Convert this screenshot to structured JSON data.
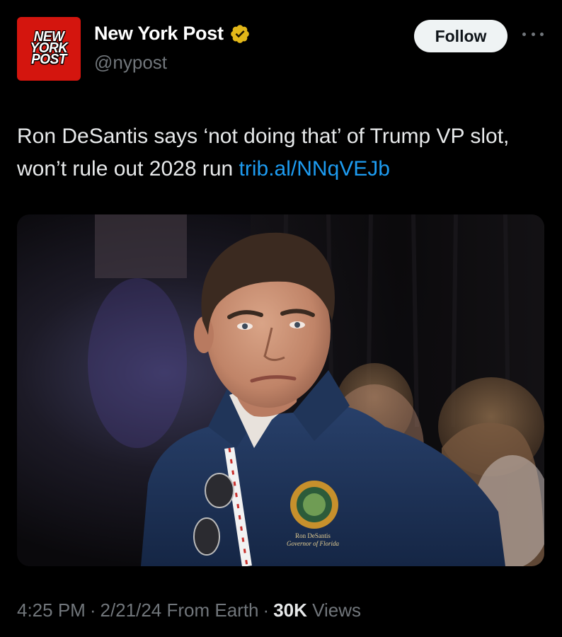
{
  "account": {
    "avatar_lines": [
      "NEW",
      "YORK",
      "POST"
    ],
    "name": "New York Post",
    "handle": "@nypost",
    "verified": true,
    "verified_icon": "verified-badge-icon",
    "badge_color": "#e2b719"
  },
  "actions": {
    "follow_label": "Follow",
    "more_icon": "more-options-icon"
  },
  "tweet": {
    "text": "Ron DeSantis says ‘not doing that’ of Trump VP slot, won’t rule out 2028 run",
    "link_text": "trib.al/NNqVEJb"
  },
  "media": {
    "jacket_seal_name": "Ron DeSantis",
    "jacket_seal_title": "Governor of Florida"
  },
  "meta": {
    "time": "4:25 PM",
    "date": "2/21/24",
    "source": "From Earth",
    "views_count": "30K",
    "views_label": "Views"
  },
  "colors": {
    "background": "#000000",
    "text_primary": "#e7e9ea",
    "text_secondary": "#71767b",
    "link": "#1d9bf0",
    "avatar_red": "#d4150e"
  }
}
